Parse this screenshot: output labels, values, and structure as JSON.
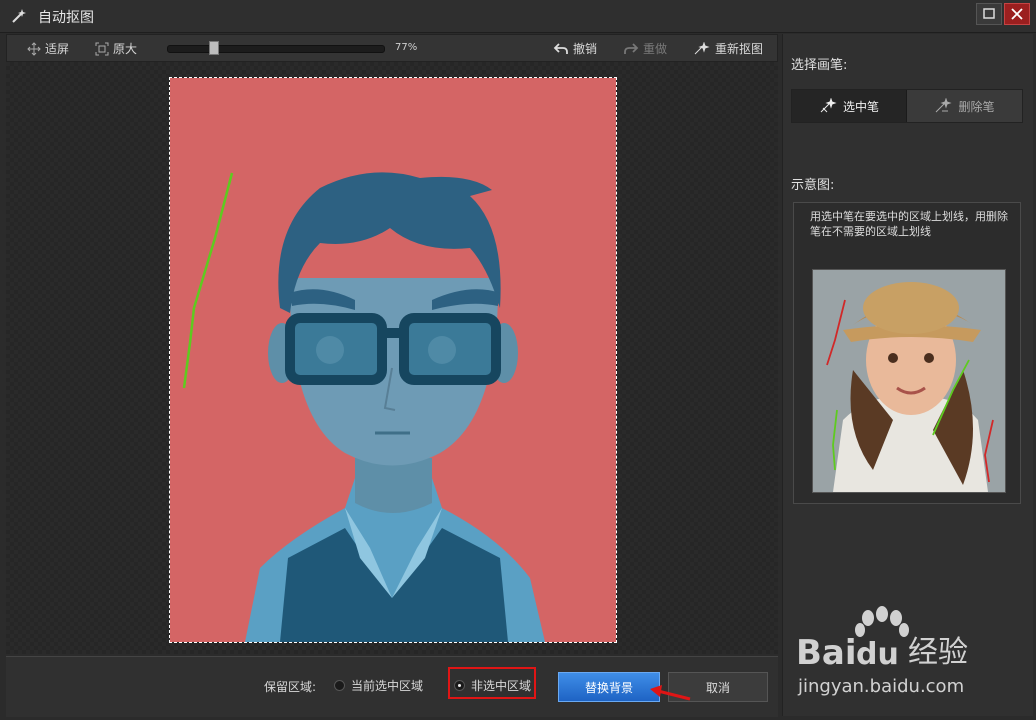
{
  "window": {
    "title": "自动抠图"
  },
  "toolbar": {
    "fit_label": "适屏",
    "original_label": "原大",
    "zoom_text": "77%",
    "zoom_level": 0.2,
    "undo_label": "撤销",
    "redo_label": "重做",
    "recut_label": "重新抠图"
  },
  "right_panel": {
    "choose_pen_label": "选择画笔:",
    "select_pen_label": "选中笔",
    "delete_pen_label": "删除笔",
    "demo_label": "示意图:",
    "demo_text": "用选中笔在要选中的区域上划线，用删除笔在不需要的区域上划线"
  },
  "bottom": {
    "keep_area_label": "保留区域:",
    "option_current": "当前选中区域",
    "option_non_selected": "非选中区域",
    "selected_option": "非选中区域",
    "replace_bg_label": "替换背景",
    "cancel_label": "取消"
  },
  "watermark": {
    "brand": "Bai du 经验",
    "url": "jingyan.baidu.com"
  },
  "colors": {
    "mask_red": "#d46565",
    "accent_blue": "#2b74d6",
    "highlight_red": "#e01515",
    "stroke_green": "#5ecb1f"
  }
}
